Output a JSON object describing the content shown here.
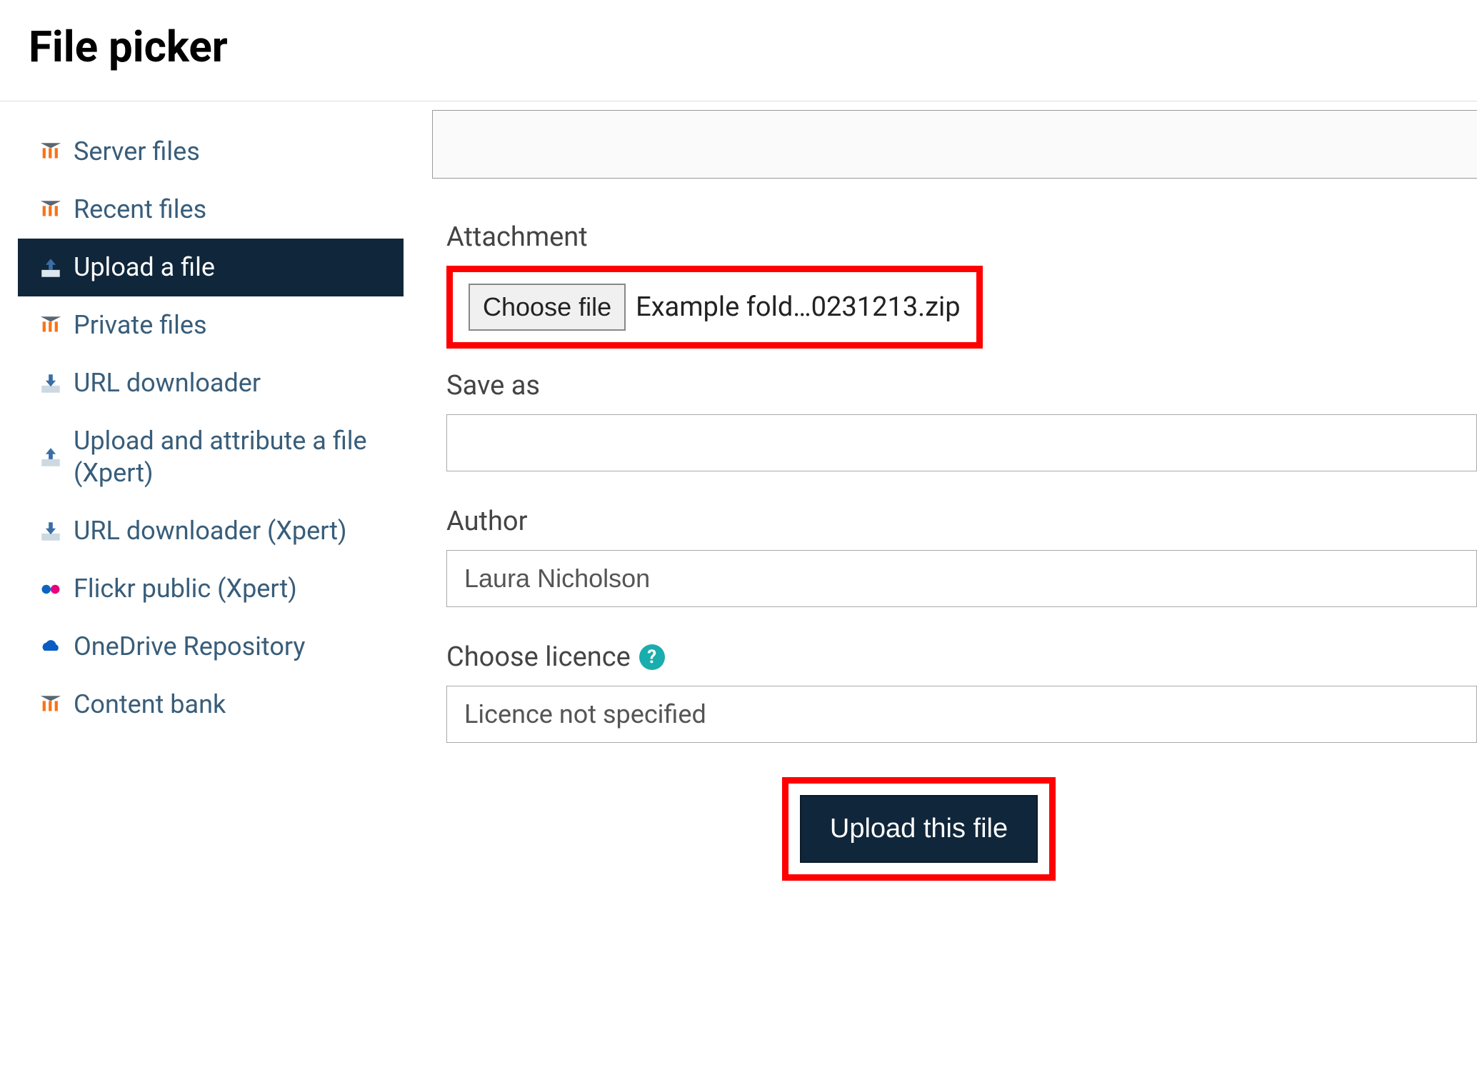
{
  "header": {
    "title": "File picker"
  },
  "sidebar": {
    "items": [
      {
        "label": "Server files",
        "icon": "moodle"
      },
      {
        "label": "Recent files",
        "icon": "moodle"
      },
      {
        "label": "Upload a file",
        "icon": "upload",
        "active": true
      },
      {
        "label": "Private files",
        "icon": "moodle"
      },
      {
        "label": "URL downloader",
        "icon": "download"
      },
      {
        "label": "Upload and attribute a file (Xpert)",
        "icon": "upload"
      },
      {
        "label": "URL downloader (Xpert)",
        "icon": "download"
      },
      {
        "label": "Flickr public (Xpert)",
        "icon": "flickr"
      },
      {
        "label": "OneDrive Repository",
        "icon": "onedrive"
      },
      {
        "label": "Content bank",
        "icon": "moodle"
      }
    ]
  },
  "form": {
    "attachment_label": "Attachment",
    "choose_file_label": "Choose file",
    "chosen_file": "Example fold…0231213.zip",
    "save_as_label": "Save as",
    "save_as_value": "",
    "author_label": "Author",
    "author_value": "Laura Nicholson",
    "licence_label": "Choose licence",
    "licence_value": "Licence not specified",
    "submit_label": "Upload this file"
  }
}
